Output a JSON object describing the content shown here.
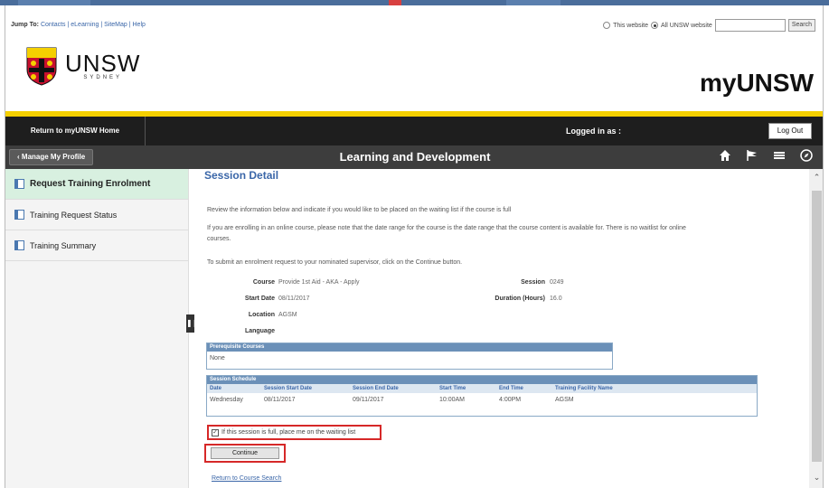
{
  "header": {
    "jump_prefix": "Jump To:",
    "jump_links": "Contacts | eLearning | SiteMap | Help",
    "search_option_this": "This website",
    "search_option_all": "All UNSW website",
    "search_button": "Search",
    "logo_main": "UNSW",
    "logo_sub": "SYDNEY",
    "brand": "myUNSW"
  },
  "topbar": {
    "home_label": "Return to myUNSW Home",
    "logged_in_label": "Logged in as :",
    "logout_label": "Log Out"
  },
  "navbar": {
    "manage_label": "Manage My Profile",
    "title": "Learning and Development",
    "icons": [
      "home-icon",
      "flag-icon",
      "menu-icon",
      "compass-icon"
    ]
  },
  "sidebar": {
    "items": [
      {
        "label": "Request Training Enrolment"
      },
      {
        "label": "Training Request Status"
      },
      {
        "label": "Training Summary"
      }
    ]
  },
  "main": {
    "heading": "Session Detail",
    "para1": "Review the information below and indicate if you would like to be placed on the waiting list if the course is full",
    "para2a": "If you are enrolling in an online course, please note that the date range for the course is the date range that the course content is available for. There is no waitlist for online",
    "para2b": "courses.",
    "para3": "To submit an enrolment request to your nominated supervisor, click on the Continue button.",
    "fields": {
      "course_label": "Course",
      "course_value": "Provide 1st Aid - AKA - Apply",
      "session_label": "Session",
      "session_value": "0249",
      "start_label": "Start Date",
      "start_value": "08/11/2017",
      "duration_label": "Duration (Hours)",
      "duration_value": "16.0",
      "location_label": "Location",
      "location_value": "AGSM",
      "language_label": "Language"
    },
    "prereq": {
      "title": "Prerequisite Courses",
      "value": "None"
    },
    "schedule": {
      "title": "Session Schedule",
      "columns": [
        "Date",
        "Session Start Date",
        "Session End Date",
        "Start Time",
        "End Time",
        "Training Facility Name"
      ],
      "rows": [
        [
          "Wednesday",
          "08/11/2017",
          "09/11/2017",
          "10:00AM",
          "4:00PM",
          "AGSM"
        ]
      ]
    },
    "waitlist_label": "If this session is full, place me on the waiting list",
    "continue_label": "Continue",
    "return_link": "Return to Course Search"
  },
  "colors": {
    "accent_blue": "#3a66a8",
    "yellow": "#f5d000",
    "highlight_red": "#d62828",
    "active_green": "#d8f0e0"
  }
}
